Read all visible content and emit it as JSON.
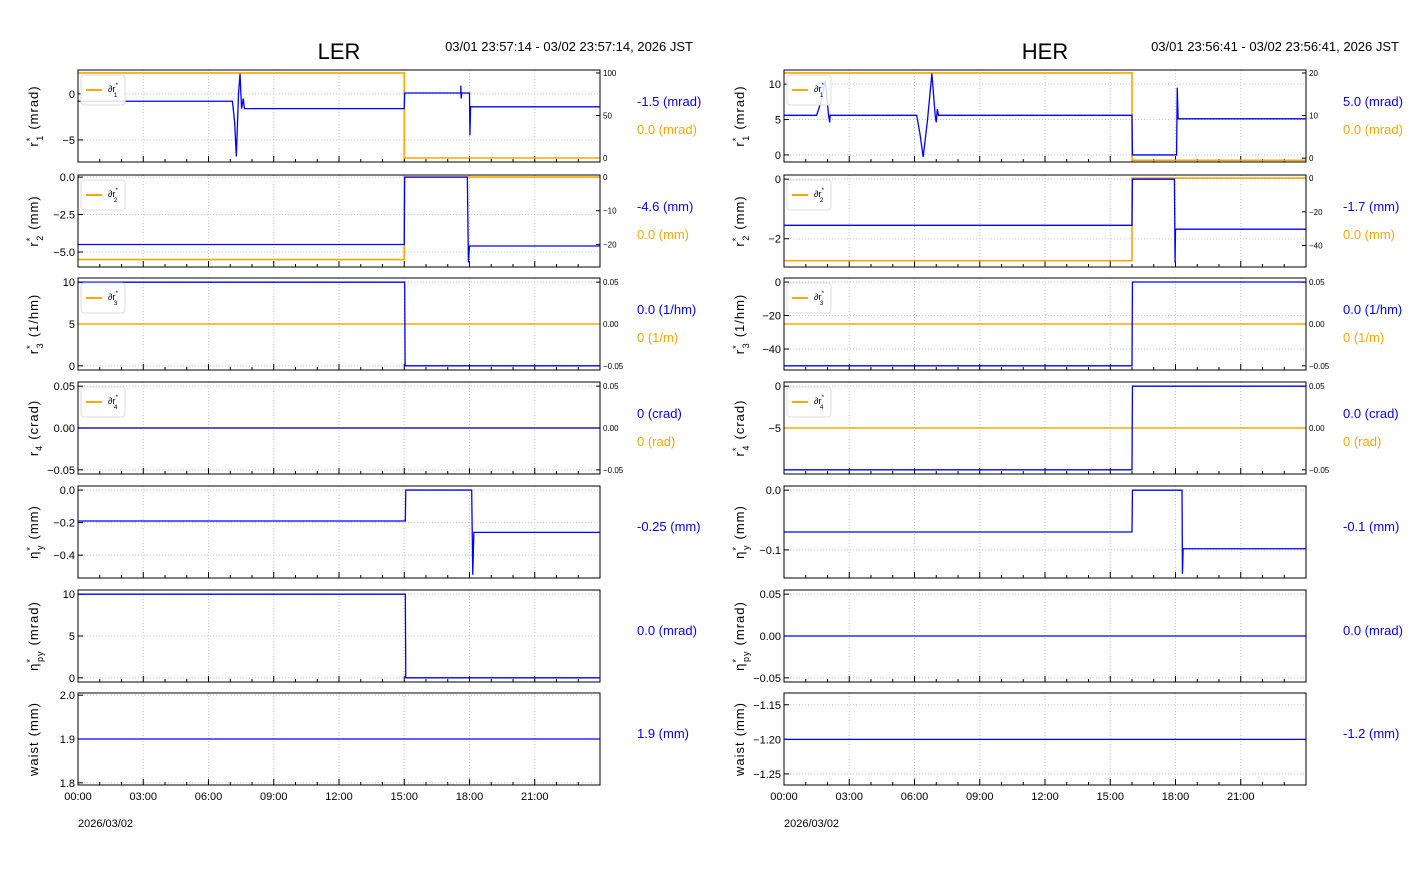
{
  "colors": {
    "primary": "#0000ff",
    "secondary": "#ffa500",
    "grid": "#c8c8c8"
  },
  "chart_data": [
    {
      "type": "line",
      "title": "LER",
      "time_range": "03/01 23:57:14 - 03/02 23:57:14, 2026 JST",
      "date_label": "2026/03/02",
      "x_ticks": [
        "00:00",
        "03:00",
        "06:00",
        "09:00",
        "12:00",
        "15:00",
        "18:00",
        "21:00"
      ],
      "xlim_hours": [
        0,
        24
      ],
      "panels": [
        {
          "ylabel": {
            "base": "r",
            "sub": "1",
            "sup": "*",
            "unit": "(mrad)"
          },
          "ylim": [
            -7.4,
            2.6
          ],
          "yticks": [
            0,
            -5
          ],
          "ytick_labels": [
            "0",
            "−5"
          ],
          "ylim_right": [
            -4.7,
            103.5
          ],
          "yticks_right": [
            100,
            50,
            0
          ],
          "ytick_labels_right": [
            "100",
            "50",
            "0"
          ],
          "legend": {
            "base": "∂r",
            "sub": "1",
            "sup": "*"
          },
          "readouts": [
            "-1.5 (mrad)",
            "0.0 (mrad)"
          ],
          "primary": [
            [
              0,
              -0.8
            ],
            [
              7.1,
              -0.8
            ],
            [
              7.2,
              -3
            ],
            [
              7.28,
              -6.8
            ],
            [
              7.38,
              0
            ],
            [
              7.45,
              2.2
            ],
            [
              7.52,
              -1.6
            ],
            [
              7.6,
              -0.5
            ],
            [
              7.65,
              -1.6
            ],
            [
              15.0,
              -1.6
            ],
            [
              15.02,
              0.1
            ],
            [
              17.6,
              0.1
            ],
            [
              17.6,
              0.9
            ],
            [
              17.62,
              -0.5
            ],
            [
              17.64,
              0.1
            ],
            [
              18.0,
              0.1
            ],
            [
              18.02,
              -4.5
            ],
            [
              18.05,
              -1.4
            ],
            [
              24,
              -1.4
            ]
          ],
          "secondary": [
            [
              0,
              100
            ],
            [
              15.0,
              100
            ],
            [
              15.0,
              0
            ],
            [
              24,
              0
            ]
          ]
        },
        {
          "ylabel": {
            "base": "r",
            "sub": "2",
            "sup": "*",
            "unit": "(mm)"
          },
          "ylim": [
            -6.0,
            0.14
          ],
          "yticks": [
            0,
            -2.5,
            -5
          ],
          "ytick_labels": [
            "0.0",
            "−2.5",
            "−5.0"
          ],
          "ylim_right": [
            -26.7,
            0.6
          ],
          "yticks_right": [
            0,
            -10,
            -20
          ],
          "ytick_labels_right": [
            "0",
            "−10",
            "−20"
          ],
          "legend": {
            "base": "∂r",
            "sub": "2",
            "sup": "*"
          },
          "readouts": [
            "-4.6 (mm)",
            "0.0 (mm)"
          ],
          "primary": [
            [
              0,
              -4.5
            ],
            [
              15.0,
              -4.5
            ],
            [
              15.02,
              0
            ],
            [
              17.9,
              0
            ],
            [
              17.95,
              -5.7
            ],
            [
              18.0,
              -4.6
            ],
            [
              24,
              -4.6
            ]
          ],
          "secondary": [
            [
              0,
              -24.5
            ],
            [
              15.0,
              -24.5
            ],
            [
              15.0,
              0
            ],
            [
              24,
              0
            ]
          ]
        },
        {
          "ylabel": {
            "base": "r",
            "sub": "3",
            "sup": "*",
            "unit": "(1/hm)"
          },
          "ylim": [
            -0.5,
            10.5
          ],
          "yticks": [
            10,
            5,
            0
          ],
          "ytick_labels": [
            "10",
            "5",
            "0"
          ],
          "ylim_right": [
            -0.055,
            0.055
          ],
          "yticks_right": [
            0.05,
            0,
            -0.05
          ],
          "ytick_labels_right": [
            "0.05",
            "0.00",
            "−0.05"
          ],
          "legend": {
            "base": "∂r",
            "sub": "3",
            "sup": "*"
          },
          "readouts": [
            "0.0 (1/hm)",
            "0 (1/m)"
          ],
          "primary": [
            [
              0,
              10
            ],
            [
              15.02,
              10
            ],
            [
              15.04,
              0
            ],
            [
              24,
              0
            ]
          ],
          "secondary": [
            [
              0,
              0
            ],
            [
              24,
              0
            ]
          ]
        },
        {
          "ylabel": {
            "base": "r",
            "sub": "4",
            "sup": "",
            "unit": "(crad)"
          },
          "ylim": [
            -0.055,
            0.055
          ],
          "yticks": [
            0.05,
            0,
            -0.05
          ],
          "ytick_labels": [
            "0.05",
            "0.00",
            "−0.05"
          ],
          "ylim_right": [
            -0.055,
            0.055
          ],
          "yticks_right": [
            0.05,
            0,
            -0.05
          ],
          "ytick_labels_right": [
            "0.05",
            "0.00",
            "−0.05"
          ],
          "legend": {
            "base": "∂r",
            "sub": "4",
            "sup": "*"
          },
          "readouts": [
            "0 (crad)",
            "0 (rad)"
          ],
          "primary": [
            [
              0,
              0
            ],
            [
              24,
              0
            ]
          ],
          "secondary": [
            [
              0,
              0
            ],
            [
              24,
              0
            ]
          ]
        },
        {
          "ylabel": {
            "base": "η",
            "sub": "y",
            "sup": "*",
            "unit": "(mm)"
          },
          "ylim": [
            -0.54,
            0.025
          ],
          "yticks": [
            0,
            -0.2,
            -0.4
          ],
          "ytick_labels": [
            "0.0",
            "−0.2",
            "−0.4"
          ],
          "readouts": [
            "-0.25 (mm)"
          ],
          "primary": [
            [
              0,
              -0.19
            ],
            [
              15.05,
              -0.19
            ],
            [
              15.07,
              0
            ],
            [
              18.1,
              0
            ],
            [
              18.15,
              -0.52
            ],
            [
              18.2,
              -0.26
            ],
            [
              24,
              -0.26
            ]
          ]
        },
        {
          "ylabel": {
            "base": "η",
            "sub": "py",
            "sup": "*",
            "unit": "(mrad)"
          },
          "ylim": [
            -0.5,
            10.5
          ],
          "yticks": [
            10,
            5,
            0
          ],
          "ytick_labels": [
            "10",
            "5",
            "0"
          ],
          "readouts": [
            "0.0 (mrad)"
          ],
          "primary": [
            [
              0,
              10
            ],
            [
              15.05,
              10
            ],
            [
              15.07,
              0
            ],
            [
              24,
              0
            ]
          ]
        },
        {
          "ylabel": {
            "base": "waist",
            "sub": "",
            "sup": "",
            "unit": "(mm)"
          },
          "ylim": [
            1.795,
            2.005
          ],
          "yticks": [
            2.0,
            1.9,
            1.8
          ],
          "ytick_labels": [
            "2.0",
            "1.9",
            "1.8"
          ],
          "readouts": [
            "1.9 (mm)"
          ],
          "primary": [
            [
              0,
              1.9
            ],
            [
              24,
              1.9
            ]
          ]
        }
      ]
    },
    {
      "type": "line",
      "title": "HER",
      "time_range": "03/01 23:56:41 - 03/02 23:56:41, 2026 JST",
      "date_label": "2026/03/02",
      "x_ticks": [
        "00:00",
        "03:00",
        "06:00",
        "09:00",
        "12:00",
        "15:00",
        "18:00",
        "21:00"
      ],
      "xlim_hours": [
        0,
        24
      ],
      "panels": [
        {
          "ylabel": {
            "base": "r",
            "sub": "1",
            "sup": "*",
            "unit": "(mrad)"
          },
          "ylim": [
            -1,
            12
          ],
          "yticks": [
            10,
            5,
            0
          ],
          "ytick_labels": [
            "10",
            "5",
            "0"
          ],
          "ylim_right": [
            -0.9,
            20.7
          ],
          "yticks_right": [
            20,
            10,
            0
          ],
          "ytick_labels_right": [
            "20",
            "10",
            "0"
          ],
          "legend": {
            "base": "∂r",
            "sub": "1",
            "sup": "*"
          },
          "readouts": [
            "5.0 (mrad)",
            "0.0 (mrad)"
          ],
          "primary": [
            [
              0,
              5.6
            ],
            [
              1.5,
              5.6
            ],
            [
              1.7,
              7.5
            ],
            [
              1.9,
              10.5
            ],
            [
              2.05,
              5.6
            ],
            [
              2.1,
              4.6
            ],
            [
              2.12,
              5.6
            ],
            [
              6.1,
              5.6
            ],
            [
              6.25,
              3
            ],
            [
              6.4,
              -0.3
            ],
            [
              6.6,
              5
            ],
            [
              6.8,
              11.5
            ],
            [
              6.95,
              5.6
            ],
            [
              7.0,
              4.6
            ],
            [
              7.05,
              6.5
            ],
            [
              7.1,
              5.6
            ],
            [
              16.0,
              5.6
            ],
            [
              16.02,
              0
            ],
            [
              18.05,
              0
            ],
            [
              18.08,
              9.5
            ],
            [
              18.12,
              5.1
            ],
            [
              24,
              5.1
            ]
          ],
          "secondary": [
            [
              0,
              20
            ],
            [
              16.0,
              20
            ],
            [
              16.0,
              -0.5
            ],
            [
              24,
              -0.5
            ]
          ]
        },
        {
          "ylabel": {
            "base": "r",
            "sub": "2",
            "sup": "*",
            "unit": "(mm)"
          },
          "ylim": [
            -2.95,
            0.14
          ],
          "yticks": [
            0,
            -2
          ],
          "ytick_labels": [
            "0",
            "−2"
          ],
          "ylim_right": [
            -52.7,
            1.8
          ],
          "yticks_right": [
            0,
            -20,
            -40
          ],
          "ytick_labels_right": [
            "0",
            "−20",
            "−40"
          ],
          "legend": {
            "base": "∂r",
            "sub": "2",
            "sup": "*"
          },
          "readouts": [
            "-1.7 (mm)",
            "0.0 (mm)"
          ],
          "primary": [
            [
              0,
              -1.55
            ],
            [
              16.0,
              -1.55
            ],
            [
              16.02,
              0
            ],
            [
              17.95,
              0
            ],
            [
              17.98,
              -2.8
            ],
            [
              18.0,
              -1.68
            ],
            [
              24,
              -1.68
            ]
          ],
          "secondary": [
            [
              0,
              -49
            ],
            [
              16.0,
              -49
            ],
            [
              16.0,
              0
            ],
            [
              24,
              0
            ]
          ]
        },
        {
          "ylabel": {
            "base": "r",
            "sub": "3",
            "sup": "*",
            "unit": "(1/hm)"
          },
          "ylim": [
            -52.5,
            2.4
          ],
          "yticks": [
            0,
            -20,
            -40
          ],
          "ytick_labels": [
            "0",
            "−20",
            "−40"
          ],
          "ylim_right": [
            -0.055,
            0.055
          ],
          "yticks_right": [
            0.05,
            0,
            -0.05
          ],
          "ytick_labels_right": [
            "0.05",
            "0.00",
            "−0.05"
          ],
          "legend": {
            "base": "∂r",
            "sub": "3",
            "sup": "*"
          },
          "readouts": [
            "0.0 (1/hm)",
            "0 (1/m)"
          ],
          "primary": [
            [
              0,
              -50
            ],
            [
              16.0,
              -50
            ],
            [
              16.02,
              0
            ],
            [
              24,
              0
            ]
          ],
          "secondary": [
            [
              0,
              0
            ],
            [
              24,
              0
            ]
          ]
        },
        {
          "ylabel": {
            "base": "r",
            "sub": "4",
            "sup": "*",
            "unit": "(crad)"
          },
          "ylim": [
            -10.5,
            0.5
          ],
          "yticks": [
            0,
            -5
          ],
          "ytick_labels": [
            "0",
            "−5"
          ],
          "ylim_right": [
            -0.055,
            0.055
          ],
          "yticks_right": [
            0.05,
            0,
            -0.05
          ],
          "ytick_labels_right": [
            "0.05",
            "0.00",
            "−0.05"
          ],
          "legend": {
            "base": "∂r",
            "sub": "4",
            "sup": "*"
          },
          "readouts": [
            "0.0 (crad)",
            "0 (rad)"
          ],
          "primary": [
            [
              0,
              -10
            ],
            [
              16.0,
              -10
            ],
            [
              16.02,
              0
            ],
            [
              24,
              0
            ]
          ],
          "secondary": [
            [
              0,
              0
            ],
            [
              24,
              0
            ]
          ]
        },
        {
          "ylabel": {
            "base": "η",
            "sub": "y",
            "sup": "*",
            "unit": "(mm)"
          },
          "ylim": [
            -0.147,
            0.007
          ],
          "yticks": [
            0,
            -0.1
          ],
          "ytick_labels": [
            "0.0",
            "−0.1"
          ],
          "readouts": [
            "-0.1 (mm)"
          ],
          "primary": [
            [
              0,
              -0.07
            ],
            [
              16.0,
              -0.07
            ],
            [
              16.02,
              0
            ],
            [
              18.3,
              0
            ],
            [
              18.32,
              -0.14
            ],
            [
              18.35,
              -0.098
            ],
            [
              24,
              -0.098
            ]
          ]
        },
        {
          "ylabel": {
            "base": "η",
            "sub": "py",
            "sup": "*",
            "unit": "(mrad)"
          },
          "ylim": [
            -0.055,
            0.055
          ],
          "yticks": [
            0.05,
            0,
            -0.05
          ],
          "ytick_labels": [
            "0.05",
            "0.00",
            "−0.05"
          ],
          "readouts": [
            "0.0 (mrad)"
          ],
          "primary": [
            [
              0,
              0
            ],
            [
              24,
              0
            ]
          ]
        },
        {
          "ylabel": {
            "base": "waist",
            "sub": "",
            "sup": "",
            "unit": "(mm)"
          },
          "ylim": [
            -1.266,
            -1.133
          ],
          "yticks": [
            -1.15,
            -1.2,
            -1.25
          ],
          "ytick_labels": [
            "−1.15",
            "−1.20",
            "−1.25"
          ],
          "readouts": [
            "-1.2 (mm)"
          ],
          "primary": [
            [
              0,
              -1.2
            ],
            [
              24,
              -1.2
            ]
          ]
        }
      ]
    }
  ]
}
